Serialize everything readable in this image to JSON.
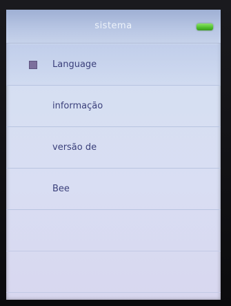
{
  "header": {
    "title": "sistema",
    "battery_icon": "battery-full-icon",
    "battery_color": "#4fbf2c"
  },
  "menu": {
    "items": [
      {
        "label": "Language",
        "selected": true
      },
      {
        "label": "informação",
        "selected": false
      },
      {
        "label": "versão de",
        "selected": false
      },
      {
        "label": "Bee",
        "selected": false
      }
    ],
    "selection_icon": "selection-square-icon"
  },
  "colors": {
    "title_bar": "#b7c5e3",
    "screen_background": "#d6dff2",
    "menu_text": "#3a3f7a"
  }
}
